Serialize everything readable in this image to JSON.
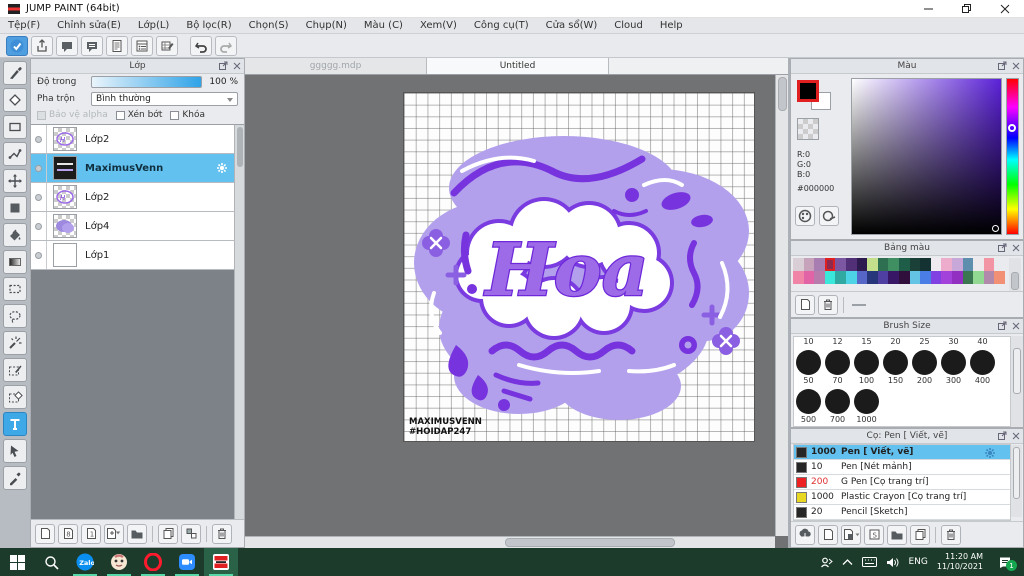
{
  "window": {
    "title": "JUMP PAINT (64bit)"
  },
  "menu": {
    "items": [
      "Tệp(F)",
      "Chỉnh sửa(E)",
      "Lớp(L)",
      "Bộ lọc(R)",
      "Chọn(S)",
      "Chụp(N)",
      "Màu (C)",
      "Xem(V)",
      "Công cụ(T)",
      "Cửa sổ(W)",
      "Cloud",
      "Help"
    ]
  },
  "top_toolbar": {
    "buttons": [
      "check",
      "share",
      "chat-filled",
      "comment",
      "document",
      "panel-list",
      "grid-edit",
      "undo",
      "redo"
    ],
    "active": "check"
  },
  "tool_strip": {
    "tools": [
      "brush",
      "eraser",
      "rectangle",
      "polyline",
      "move",
      "fill-rect",
      "bucket",
      "gradient",
      "select-rect",
      "select-lasso",
      "magic-wand",
      "select-pen",
      "select-eraser",
      "text",
      "shape-select",
      "eyedropper"
    ],
    "selected": "text"
  },
  "layers_panel": {
    "title": "Lớp",
    "opacity_label": "Độ trong",
    "opacity_value": "100 %",
    "blend_label": "Pha trộn",
    "blend_value": "Bình thường",
    "checkboxes": [
      {
        "label": "Bảo vệ alpha",
        "disabled": true
      },
      {
        "label": "Xén bớt",
        "disabled": false
      },
      {
        "label": "Khóa",
        "disabled": false
      }
    ],
    "layers": [
      {
        "name": "Lớp2",
        "thumb": "art",
        "selected": false
      },
      {
        "name": "MaximusVenn",
        "thumb": "dark",
        "selected": true
      },
      {
        "name": "Lớp2",
        "thumb": "art",
        "selected": false
      },
      {
        "name": "Lớp4",
        "thumb": "blob",
        "selected": false
      },
      {
        "name": "Lớp1",
        "thumb": "white",
        "selected": false
      }
    ],
    "bottom_buttons": [
      "new-layer",
      "new-8bit-layer",
      "new-1bit-layer",
      "add-layer-dropdown",
      "new-folder",
      "duplicate-layer",
      "merge-layer",
      "delete-layer"
    ]
  },
  "canvas": {
    "tabs": [
      {
        "label": "ggggg.mdp",
        "active": false
      },
      {
        "label": "Untitled",
        "active": true
      }
    ],
    "artwork_text": "Hoa",
    "watermark_line1": "MAXIMUSVENN",
    "watermark_line2": "#HOIDAP247",
    "art_colors": {
      "cloud": "#b2a0ec",
      "deco": "#7733dd",
      "letters": "#9d6ae8",
      "letter_outline": "#6d28d9"
    }
  },
  "color_panel": {
    "title": "Màu",
    "r": "R:0",
    "g": "G:0",
    "b": "B:0",
    "hex": "#000000"
  },
  "palette_panel": {
    "title": "Bảng màu",
    "row1": [
      "#d9cdd6",
      "#c7a2bb",
      "#a77db2",
      "#8e2a50",
      "#7c57a2",
      "#523077",
      "#2d1b50",
      "#c5e08c",
      "#2e6e51",
      "#3f8f63",
      "#1e5d47",
      "#1a4038",
      "#143231",
      "#efeaef",
      "#eeaccd",
      "#c8a8d9",
      "#5e8ead",
      "#ece8eb",
      "#f294a3"
    ],
    "row2": [
      "#f085a8",
      "#e263a6",
      "#b77cab",
      "#39e8da",
      "#2fa9a1",
      "#4cd3e6",
      "#5566c6",
      "#27367a",
      "#4f3fa2",
      "#371766",
      "#300f3c",
      "#64c4e6",
      "#4a7ee6",
      "#8140e2",
      "#a242da",
      "#9230c2",
      "#3a7751",
      "#92d892",
      "#b189aa",
      "#f29076"
    ],
    "selected_row": 0,
    "selected_index": 3,
    "bottom_buttons": [
      "new-color",
      "delete-color"
    ]
  },
  "brush_size_panel": {
    "title": "Brush Size",
    "rows": [
      [
        "10",
        "12",
        "15",
        "20",
        "25",
        "30",
        "40"
      ],
      [
        "50",
        "70",
        "100",
        "150",
        "200",
        "300",
        "400"
      ],
      [
        "500",
        "700",
        "1000"
      ]
    ]
  },
  "brush_panel": {
    "title": "Cọ: Pen [ Viết, vẽ]",
    "brushes": [
      {
        "swatch": "#262626",
        "size": "1000",
        "name": "Pen [ Viết, vẽ]",
        "selected": true,
        "red": false
      },
      {
        "swatch": "#262626",
        "size": "10",
        "name": "Pen [Nét mảnh]",
        "selected": false,
        "red": false
      },
      {
        "swatch": "#ee2222",
        "size": "200",
        "name": "G Pen [Cọ trang trí]",
        "selected": false,
        "red": true
      },
      {
        "swatch": "#e8d822",
        "size": "1000",
        "name": "Plastic Crayon [Cọ trang trí]",
        "selected": false,
        "red": false
      },
      {
        "swatch": "#262626",
        "size": "20",
        "name": "Pencil [Sketch]",
        "selected": false,
        "red": false
      },
      {
        "swatch": "#f0b8d0",
        "size": "",
        "name": "",
        "selected": false,
        "red": false,
        "partial": true
      }
    ],
    "bottom_buttons": [
      "cloud-brush",
      "new-brush",
      "add-brush-dropdown",
      "script-brush",
      "brush-folder",
      "duplicate-brush",
      "delete-brush"
    ]
  },
  "taskbar": {
    "apps": [
      "start",
      "search",
      "zalo",
      "medibang",
      "opera",
      "zoom-app",
      "jump-paint"
    ],
    "running": [
      "zalo",
      "medibang",
      "opera",
      "zoom-app",
      "jump-paint"
    ],
    "active": "jump-paint",
    "zalo_label": "Zalo",
    "lang": "ENG",
    "time": "11:20 AM",
    "date": "11/10/2021",
    "badge": "1"
  }
}
